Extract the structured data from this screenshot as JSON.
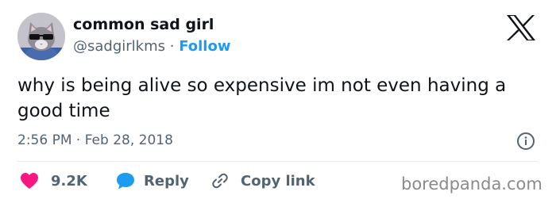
{
  "author": {
    "display_name": "common sad girl",
    "handle": "@sadgirlkms",
    "separator": "·",
    "follow_label": "Follow",
    "avatar": "cat-with-sunglasses"
  },
  "brand": {
    "logo_icon": "x-logo-icon"
  },
  "tweet": {
    "text": "why is being alive so expensive im not even having a good time",
    "timestamp": "2:56 PM · Feb 28, 2018"
  },
  "actions": {
    "like_count": "9.2K",
    "reply_label": "Reply",
    "copy_link_label": "Copy link"
  },
  "watermark": "boredpanda.com",
  "colors": {
    "text": "#0f1419",
    "secondary": "#536471",
    "link": "#1d9bf0",
    "like": "#f91880",
    "reply": "#1d9bf0"
  }
}
